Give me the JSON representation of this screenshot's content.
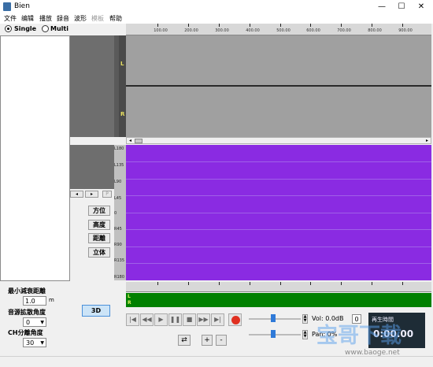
{
  "window": {
    "title": "Bien",
    "controls": [
      "—",
      "☐",
      "✕"
    ]
  },
  "menu": [
    {
      "label": "文件",
      "disabled": false
    },
    {
      "label": "编辑",
      "disabled": false
    },
    {
      "label": "播放",
      "disabled": false
    },
    {
      "label": "録音",
      "disabled": false
    },
    {
      "label": "波形",
      "disabled": false
    },
    {
      "label": "模板",
      "disabled": true
    },
    {
      "label": "帮助",
      "disabled": false
    }
  ],
  "mode": {
    "single_label": "Single",
    "multi_label": "Multi",
    "selected": "Single"
  },
  "ruler": {
    "labels": [
      "100.00",
      "200.00",
      "300.00",
      "400.00",
      "500.00",
      "600.00",
      "700.00",
      "800.00",
      "900.00"
    ]
  },
  "tracks": {
    "left": "L",
    "right": "R"
  },
  "angle_axis": {
    "labels": [
      "L180",
      "L135",
      "L90",
      "L45",
      "0",
      "R45",
      "R90",
      "R135",
      "R180"
    ]
  },
  "small_nav": {
    "prev": "◂",
    "next": "▸",
    "p": "P"
  },
  "side_buttons": {
    "direction": "方位",
    "height": "高度",
    "distance": "距離",
    "stereo": "立体"
  },
  "params": {
    "min_decay_label": "最小減衰距離",
    "min_decay_value": "1.0",
    "min_decay_unit": "m",
    "spread_label": "音源拡散角度",
    "spread_value": "0",
    "ch_label": "CH分離角度",
    "ch_value": "30"
  },
  "btn_3d": "3D",
  "transport": [
    "|◀",
    "◀◀",
    "▶",
    "❚❚",
    "■",
    "▶▶",
    "▶|"
  ],
  "volume": {
    "label": "Vol: 0.0dB",
    "value": "0"
  },
  "pan": {
    "label": "Pan: 0%"
  },
  "display": {
    "title": "再生時間",
    "time": "0:00.00"
  },
  "buttons": {
    "loop": "⇄",
    "plus": "+",
    "minus": "-"
  },
  "watermark": {
    "cn": "宝哥下载",
    "url": "www.baoge.net"
  },
  "colors": {
    "waveform_bg": "#a0a0a0",
    "angle_bg": "#8a2be2",
    "level_bg": "#008000",
    "accent": "#2f7ad8"
  }
}
